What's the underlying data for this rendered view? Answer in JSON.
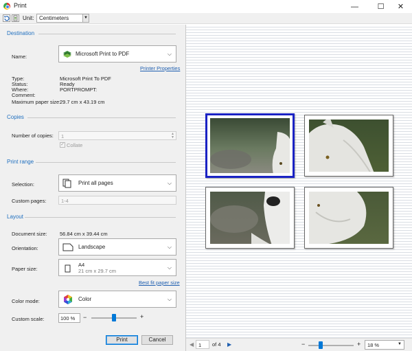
{
  "window": {
    "title": "Print",
    "minimize_glyph": "—",
    "maximize_glyph": "☐",
    "close_glyph": "✕"
  },
  "toolbar": {
    "unit_label": "Unit:",
    "unit_value": "Centimeters"
  },
  "destination": {
    "section": "Destination",
    "name_label": "Name:",
    "printer": "Microsoft Print to PDF",
    "printer_properties": "Printer Properties",
    "type_label": "Type:",
    "type_value": "Microsoft Print To PDF",
    "status_label": "Status:",
    "status_value": "Ready",
    "where_label": "Where:",
    "where_value": "PORTPROMPT:",
    "comment_label": "Comment:",
    "comment_value": "",
    "max_paper_label": "Maximum paper size:",
    "max_paper_value": "29.7 cm x 43.19 cm"
  },
  "copies": {
    "section": "Copies",
    "number_label": "Number of copies:",
    "number_value": "1",
    "collate_label": "Collate",
    "collate_checked": true
  },
  "print_range": {
    "section": "Print range",
    "selection_label": "Selection:",
    "selection_value": "Print all pages",
    "custom_label": "Custom pages:",
    "custom_value": "1-4"
  },
  "layout": {
    "section": "Layout",
    "doc_size_label": "Document size:",
    "doc_size_value": "56.84 cm x 39.44 cm",
    "orientation_label": "Orientation:",
    "orientation_value": "Landscape",
    "paper_size_label": "Paper size:",
    "paper_name": "A4",
    "paper_dims": "21 cm x 29.7 cm",
    "best_fit": "Best fit paper size",
    "color_mode_label": "Color mode:",
    "color_mode_value": "Color",
    "custom_scale_label": "Custom scale:",
    "custom_scale_value": "100 %",
    "minus": "−",
    "plus": "+",
    "scale_fraction": 0.5
  },
  "buttons": {
    "print": "Print",
    "cancel": "Cancel"
  },
  "preview": {
    "current_page": "1",
    "of_label": "of 4",
    "zoom_minus": "−",
    "zoom_plus": "+",
    "zoom_value": "18 %",
    "zoom_fraction": 0.25
  },
  "colors": {
    "accent": "#1f6fbf",
    "selection_border": "#1a22c4"
  }
}
